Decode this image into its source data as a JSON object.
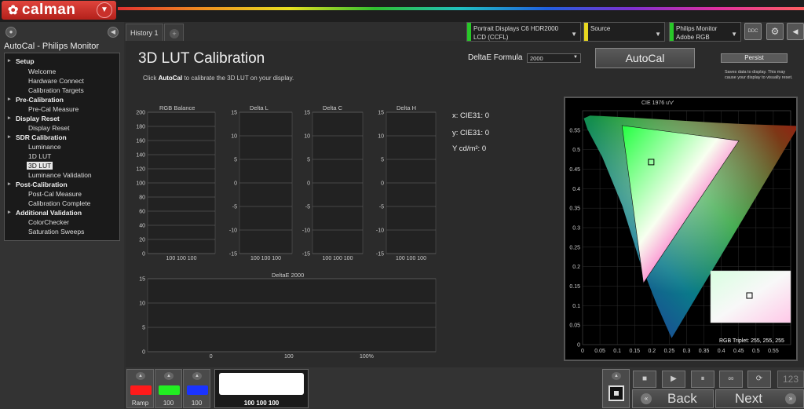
{
  "app": {
    "name": "calman"
  },
  "sidebar": {
    "title": "AutoCal - Philips Monitor",
    "groups": [
      {
        "label": "Setup",
        "items": [
          "Welcome",
          "Hardware Connect",
          "Calibration Targets"
        ]
      },
      {
        "label": "Pre-Calibration",
        "items": [
          "Pre-Cal Measure"
        ]
      },
      {
        "label": "Display Reset",
        "items": [
          "Display Reset"
        ]
      },
      {
        "label": "SDR Calibration",
        "items": [
          "Luminance",
          "1D LUT",
          "3D LUT",
          "Luminance Validation"
        ]
      },
      {
        "label": "Post-Calibration",
        "items": [
          "Post-Cal Measure",
          "Calibration Complete"
        ]
      },
      {
        "label": "Additional Validation",
        "items": [
          "ColorChecker",
          "Saturation Sweeps"
        ]
      }
    ],
    "selected": "3D LUT"
  },
  "tabs": {
    "history": "History 1"
  },
  "devices": {
    "meter": {
      "line1": "Portrait Displays C6 HDR2000",
      "line2": "LCD (CCFL)",
      "color": "#28c828"
    },
    "source": {
      "line1": "Source",
      "line2": "",
      "color": "#e8d820"
    },
    "display": {
      "line1": "Philips Monitor",
      "line2": "Adobe RGB",
      "color": "#28c828"
    }
  },
  "icons": {
    "ddc": "DDC",
    "settings": "gear-icon"
  },
  "main": {
    "title": "3D LUT Calibration",
    "subtitle_pre": "Click ",
    "subtitle_bold": "AutoCal",
    "subtitle_post": " to calibrate the 3D LUT on your display.",
    "formula_label": "DeltaE Formula",
    "formula_value": "2000",
    "autocal_label": "AutoCal",
    "persist_label": "Persist",
    "persist_note": "Saves data to display. This may cause your display to visually reset."
  },
  "readouts": {
    "x": "x: CIE31: 0",
    "y": "y: CIE31: 0",
    "Y": "Y cd/m²: 0"
  },
  "chart_data": [
    {
      "type": "bar",
      "title": "RGB Balance",
      "categories": [
        "100 100 100"
      ],
      "values": [],
      "ylim": [
        0,
        200
      ],
      "yticks": [
        "200",
        "180",
        "160",
        "140",
        "120",
        "100",
        "80",
        "60",
        "40",
        "20",
        "0"
      ]
    },
    {
      "type": "bar",
      "title": "Delta L",
      "categories": [
        "100 100 100"
      ],
      "values": [],
      "ylim": [
        -15,
        15
      ],
      "yticks": [
        "15",
        "10",
        "5",
        "0",
        "-5",
        "-10",
        "-15"
      ]
    },
    {
      "type": "bar",
      "title": "Delta C",
      "categories": [
        "100 100 100"
      ],
      "values": [],
      "ylim": [
        -15,
        15
      ],
      "yticks": [
        "15",
        "10",
        "5",
        "0",
        "-5",
        "-10",
        "-15"
      ]
    },
    {
      "type": "bar",
      "title": "Delta H",
      "categories": [
        "100 100 100"
      ],
      "values": [],
      "ylim": [
        -15,
        15
      ],
      "yticks": [
        "15",
        "10",
        "5",
        "0",
        "-5",
        "-10",
        "-15"
      ]
    },
    {
      "type": "bar",
      "title": "DeltaE 2000",
      "categories": [
        "0",
        "100",
        "100%"
      ],
      "values": [],
      "ylim": [
        0,
        15
      ],
      "yticks": [
        "15",
        "10",
        "5",
        "0"
      ]
    },
    {
      "type": "scatter",
      "title": "CIE 1976 u'v'",
      "xticks": [
        "0",
        "0.05",
        "0.1",
        "0.15",
        "0.2",
        "0.25",
        "0.3",
        "0.35",
        "0.4",
        "0.45",
        "0.5",
        "0.55"
      ],
      "yticks": [
        "0.55",
        "0.5",
        "0.45",
        "0.4",
        "0.35",
        "0.3",
        "0.25",
        "0.2",
        "0.15",
        "0.1",
        "0.05",
        "0"
      ],
      "xlim": [
        0,
        0.6
      ],
      "ylim": [
        0,
        0.6
      ],
      "target_gamut": [
        [
          0.4507,
          0.5229
        ],
        [
          0.1136,
          0.5621
        ],
        [
          0.1754,
          0.1579
        ]
      ],
      "point": [
        0.1978,
        0.4683
      ],
      "rgb_triplet": "RGB Triplet: 255, 255, 255"
    }
  ],
  "bottom": {
    "swatches": [
      {
        "label": "Ramp",
        "color": "#ff1a1a"
      },
      {
        "label": "100",
        "color": "#22ee22"
      },
      {
        "label": "100",
        "color": "#1a33ff"
      }
    ],
    "preview_label": "100 100 100",
    "back": "Back",
    "next": "Next",
    "counter": "123"
  }
}
